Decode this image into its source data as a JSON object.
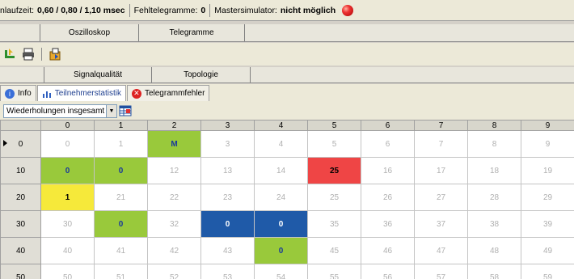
{
  "status": {
    "cycle_label": "nlaufzeit:",
    "cycle_value": "0,60 / 0,80 / 1,10 msec",
    "error_label": "Fehltelegramme:",
    "error_value": "0",
    "master_label": "Mastersimulator:",
    "master_value": "nicht möglich"
  },
  "tabs_top": [
    "Oszilloskop",
    "Telegramme"
  ],
  "tabs_mid": [
    "Signalqualität",
    "Topologie"
  ],
  "subtabs": [
    "Info",
    "Teilnehmerstatistik",
    "Telegrammfehler"
  ],
  "filter": {
    "selected": "Wiederholungen insgesamt"
  },
  "colors": {
    "green": "#99c93b",
    "yellow": "#f6e93a",
    "red": "#ef4545",
    "blue": "#1f5aa8"
  },
  "grid": {
    "columns": [
      "0",
      "1",
      "2",
      "3",
      "4",
      "5",
      "6",
      "7",
      "8",
      "9"
    ],
    "rows": [
      {
        "label": "0",
        "cells": [
          "0",
          "1",
          "M",
          "3",
          "4",
          "5",
          "6",
          "7",
          "8",
          "9"
        ],
        "styles": [
          "",
          "",
          "g",
          "",
          "",
          "",
          "",
          "",
          "",
          ""
        ]
      },
      {
        "label": "10",
        "cells": [
          "0",
          "0",
          "12",
          "13",
          "14",
          "25",
          "16",
          "17",
          "18",
          "19"
        ],
        "styles": [
          "g",
          "g",
          "",
          "",
          "",
          "r",
          "",
          "",
          "",
          ""
        ]
      },
      {
        "label": "20",
        "cells": [
          "1",
          "21",
          "22",
          "23",
          "24",
          "25",
          "26",
          "27",
          "28",
          "29"
        ],
        "styles": [
          "y",
          "",
          "",
          "",
          "",
          "",
          "",
          "",
          "",
          ""
        ]
      },
      {
        "label": "30",
        "cells": [
          "30",
          "0",
          "32",
          "0",
          "0",
          "35",
          "36",
          "37",
          "38",
          "39"
        ],
        "styles": [
          "",
          "g",
          "",
          "b",
          "b",
          "",
          "",
          "",
          "",
          ""
        ]
      },
      {
        "label": "40",
        "cells": [
          "40",
          "41",
          "42",
          "43",
          "0",
          "45",
          "46",
          "47",
          "48",
          "49"
        ],
        "styles": [
          "",
          "",
          "",
          "",
          "g",
          "",
          "",
          "",
          "",
          ""
        ]
      },
      {
        "label": "50",
        "cells": [
          "50",
          "51",
          "52",
          "53",
          "54",
          "55",
          "56",
          "57",
          "58",
          "59"
        ],
        "styles": [
          "",
          "",
          "",
          "",
          "",
          "",
          "",
          "",
          "",
          ""
        ]
      }
    ]
  }
}
